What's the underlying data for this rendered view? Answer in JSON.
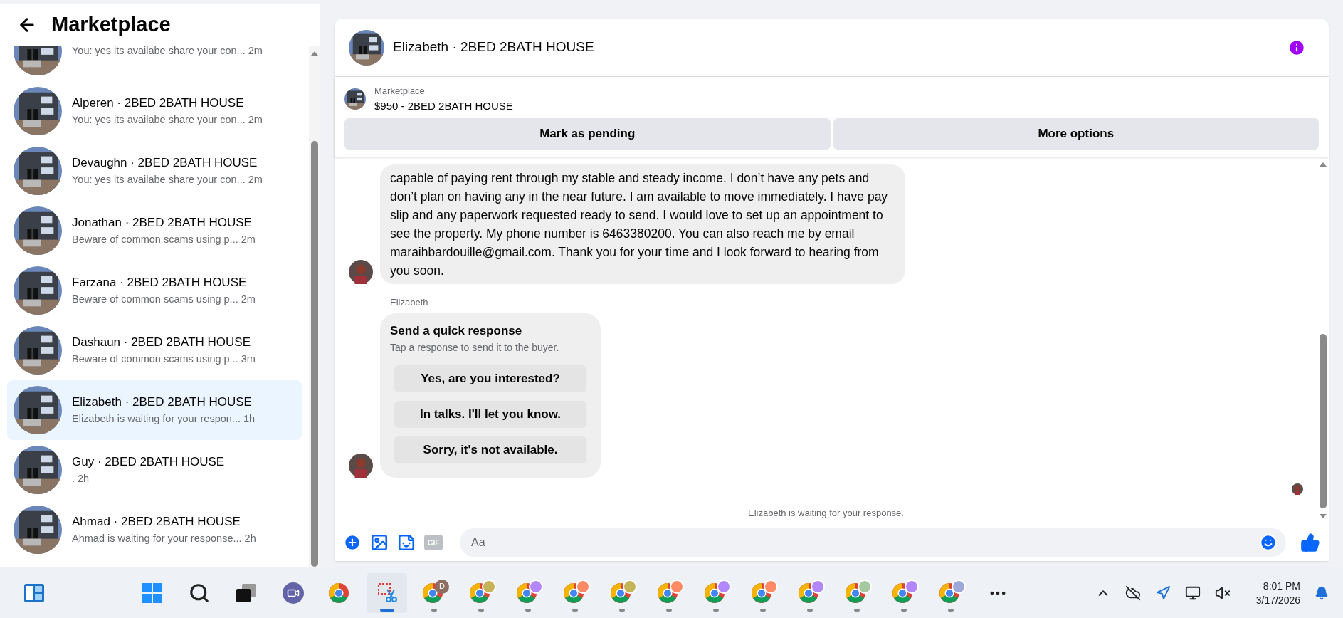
{
  "sidebar": {
    "title": "Marketplace",
    "conversations": [
      {
        "preview": "You: yes its availabe share your con...",
        "time": "2m",
        "selected": false
      },
      {
        "name": "Alperen · 2BED 2BATH HOUSE",
        "preview": "You: yes its availabe share your con...",
        "time": "2m",
        "selected": false
      },
      {
        "name": "Devaughn · 2BED 2BATH HOUSE",
        "preview": "You: yes its availabe share your con...",
        "time": "2m",
        "selected": false
      },
      {
        "name": "Jonathan · 2BED 2BATH HOUSE",
        "preview": "Beware of common scams using p...",
        "time": "2m",
        "selected": false
      },
      {
        "name": "Farzana · 2BED 2BATH HOUSE",
        "preview": "Beware of common scams using p...",
        "time": "2m",
        "selected": false
      },
      {
        "name": "Dashaun · 2BED 2BATH HOUSE",
        "preview": "Beware of common scams using p...",
        "time": "3m",
        "selected": false
      },
      {
        "name": "Elizabeth · 2BED 2BATH HOUSE",
        "preview": "Elizabeth is waiting for your respon...",
        "time": "1h",
        "selected": true
      },
      {
        "name": "Guy · 2BED 2BATH HOUSE",
        "preview": ".",
        "time": "2h",
        "selected": false
      },
      {
        "name": "Ahmad · 2BED 2BATH HOUSE",
        "preview": "Ahmad is waiting for your response...",
        "time": "2h",
        "selected": false
      }
    ]
  },
  "chat": {
    "title": "Elizabeth · 2BED 2BATH HOUSE",
    "listing": {
      "source": "Marketplace",
      "title": "$950 - 2BED 2BATH HOUSE"
    },
    "actions": [
      "Mark as pending",
      "More options"
    ],
    "message": "capable of paying rent through my stable and steady income. I don’t have any pets and don’t plan on having any in the near future. I am available to move immediately. I have pay slip and any paperwork requested ready to send. I would love to set up an appointment to see the property. My phone number is 6463380200. You can also reach me by email maraihbardouille@gmail.com. Thank you for your time and I look forward to hearing from you soon.",
    "quick_response": {
      "sender": "Elizabeth",
      "title": "Send a quick response",
      "subtitle": "Tap a response to send it to the buyer.",
      "options": [
        "Yes, are you interested?",
        "In talks. I'll let you know.",
        "Sorry, it's not available."
      ]
    },
    "status": "Elizabeth is waiting for your response.",
    "composer": {
      "gif_label": "GIF",
      "placeholder": "Aa"
    }
  },
  "taskbar": {
    "apps": [
      {
        "kind": "widgets",
        "open": false
      },
      {
        "kind": "start",
        "open": false
      },
      {
        "kind": "search",
        "open": false
      },
      {
        "kind": "taskview",
        "open": false
      },
      {
        "kind": "meet",
        "open": false
      },
      {
        "kind": "chrome",
        "open": false
      },
      {
        "kind": "snip",
        "open": true
      },
      {
        "kind": "chrome",
        "open": true,
        "badge": "D",
        "color": "#8d6e63"
      },
      {
        "kind": "chrome",
        "open": true,
        "color": "#c5b358"
      },
      {
        "kind": "chrome",
        "open": true,
        "color": "#b388ff"
      },
      {
        "kind": "chrome",
        "open": true,
        "color": "#ff8a65"
      },
      {
        "kind": "chrome",
        "open": true,
        "color": "#c5b358"
      },
      {
        "kind": "chrome",
        "open": true,
        "color": "#ff8a65"
      },
      {
        "kind": "chrome",
        "open": true,
        "color": "#b388ff"
      },
      {
        "kind": "chrome",
        "open": true,
        "color": "#ff8a65"
      },
      {
        "kind": "chrome",
        "open": true,
        "color": "#b388ff"
      },
      {
        "kind": "chrome",
        "open": true,
        "color": "#a5c8a0"
      },
      {
        "kind": "chrome",
        "open": true,
        "color": "#b388ff"
      },
      {
        "kind": "chrome",
        "open": true,
        "color": "#9fa8da"
      },
      {
        "kind": "more",
        "open": false
      }
    ],
    "time": "8:01 PM",
    "date": "3/17/2026"
  }
}
